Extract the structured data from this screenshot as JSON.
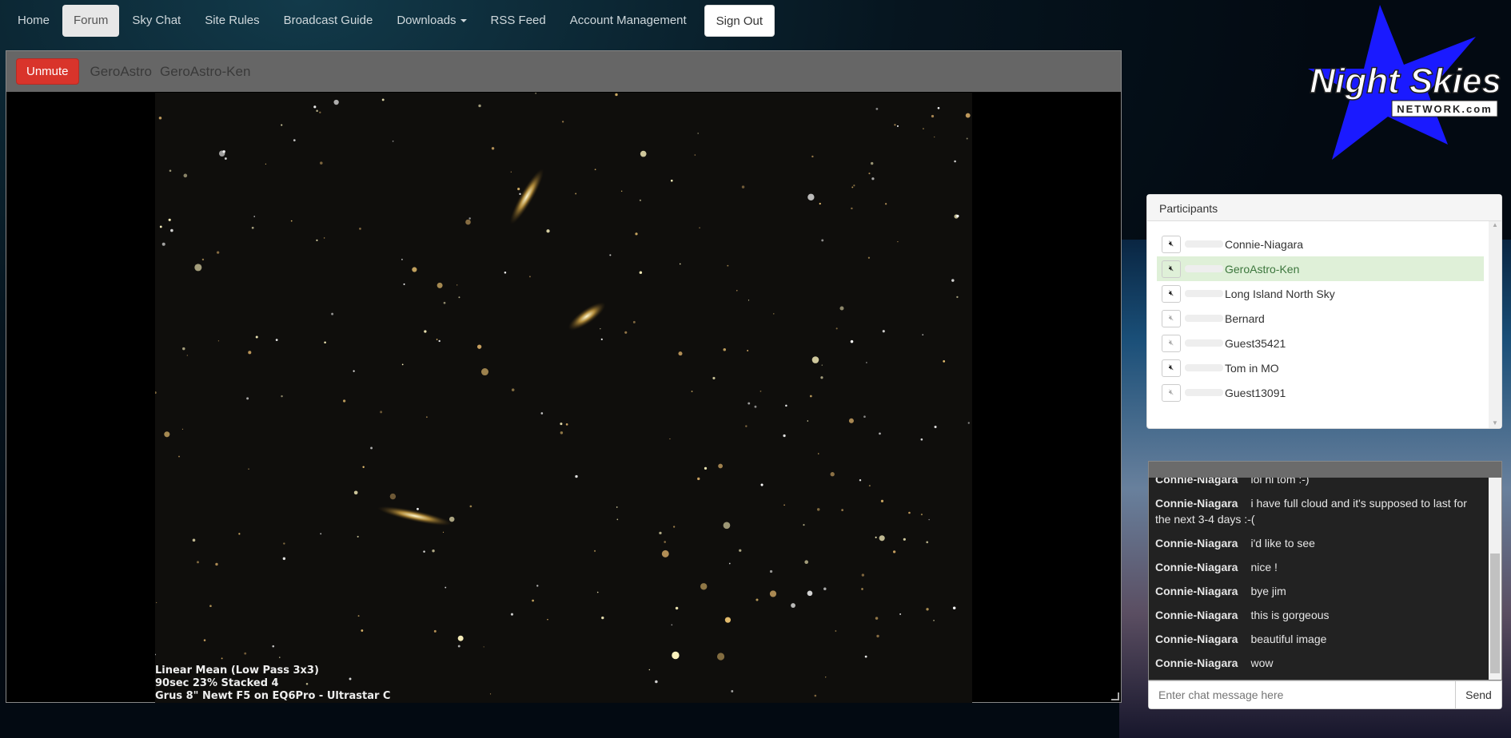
{
  "nav": {
    "items": [
      {
        "label": "Home"
      },
      {
        "label": "Forum"
      },
      {
        "label": "Sky Chat"
      },
      {
        "label": "Site Rules"
      },
      {
        "label": "Broadcast Guide"
      },
      {
        "label": "Downloads"
      },
      {
        "label": "RSS Feed"
      },
      {
        "label": "Account Management"
      }
    ],
    "signout": "Sign Out"
  },
  "video": {
    "unmute": "Unmute",
    "channel": "GeroAstro",
    "broadcaster": "GeroAstro-Ken",
    "caption": [
      "Linear Mean (Low Pass 3x3)",
      "90sec 23% Stacked 4",
      "Grus 8\" Newt F5 on EQ6Pro - Ultrastar C"
    ]
  },
  "logo": {
    "line1": "Night Skies",
    "line2": "NETWORK.com"
  },
  "participants": {
    "title": "Participants",
    "items": [
      {
        "name": "Connie-Niagara",
        "muted": false
      },
      {
        "name": "GeroAstro-Ken",
        "muted": false
      },
      {
        "name": "Long Island North Sky",
        "muted": false
      },
      {
        "name": "Bernard",
        "muted": true
      },
      {
        "name": "Guest35421",
        "muted": true
      },
      {
        "name": "Tom in MO",
        "muted": false
      },
      {
        "name": "Guest13091",
        "muted": true
      }
    ]
  },
  "chat": {
    "messages": [
      {
        "user": "Connie-Niagara",
        "text": "lol hi tom :-)"
      },
      {
        "user": "Connie-Niagara",
        "text": "i have full cloud and it's supposed to last for the next 3-4 days :-("
      },
      {
        "user": "Connie-Niagara",
        "text": "i'd like to see"
      },
      {
        "user": "Connie-Niagara",
        "text": "nice !"
      },
      {
        "user": "Connie-Niagara",
        "text": "bye jim"
      },
      {
        "user": "Connie-Niagara",
        "text": "this is gorgeous"
      },
      {
        "user": "Connie-Niagara",
        "text": "beautiful image"
      },
      {
        "user": "Connie-Niagara",
        "text": "wow"
      }
    ],
    "placeholder": "Enter chat message here",
    "send": "Send"
  }
}
